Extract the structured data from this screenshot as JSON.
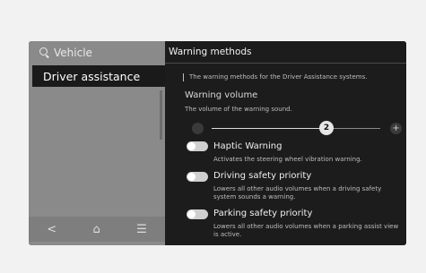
{
  "sidebar": {
    "search_label": "Vehicle",
    "active_item": "Driver assistance",
    "bottom": {
      "back": "<",
      "home": "⌂",
      "menu": "☰"
    }
  },
  "content": {
    "title": "Warning methods",
    "description": "The warning methods for the Driver Assistance systems.",
    "volume": {
      "title": "Warning volume",
      "subtitle": "The volume of the warning sound.",
      "value": "2",
      "plus": "+"
    },
    "options": [
      {
        "label": "Haptic Warning",
        "desc": "Activates the steering wheel vibration warning."
      },
      {
        "label": "Driving safety priority",
        "desc": "Lowers all other audio volumes when a driving safety system sounds a warning."
      },
      {
        "label": "Parking safety priority",
        "desc": "Lowers all other audio volumes when a parking assist view is active."
      }
    ]
  }
}
